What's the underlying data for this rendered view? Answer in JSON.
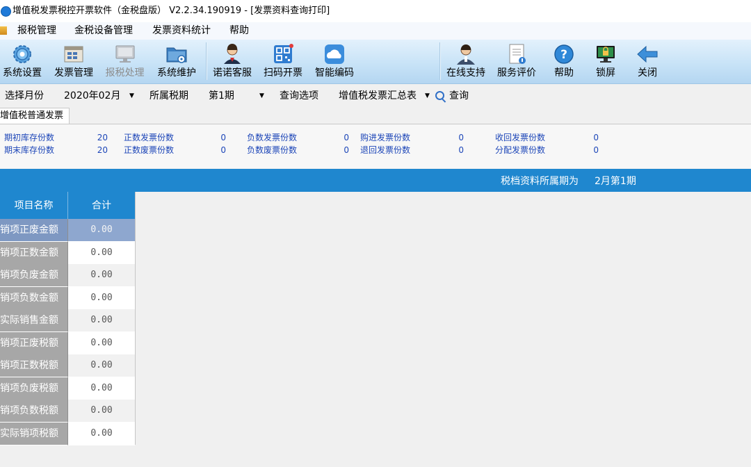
{
  "window": {
    "title": "增值税发票税控开票软件（金税盘版） V2.2.34.190919 - [发票资料查询打印]"
  },
  "menu": {
    "items": [
      "报税管理",
      "金税设备管理",
      "发票资料统计",
      "帮助"
    ]
  },
  "toolbar": {
    "buttons": [
      {
        "label": "系统设置",
        "icon": "gear-icon",
        "enabled": true
      },
      {
        "label": "发票管理",
        "icon": "invoice-manage-icon",
        "enabled": true
      },
      {
        "label": "报税处理",
        "icon": "monitor-icon",
        "enabled": false
      },
      {
        "label": "系统维护",
        "icon": "folder-gear-icon",
        "enabled": true
      },
      {
        "label": "诺诺客服",
        "icon": "customer-service-icon",
        "enabled": true
      },
      {
        "label": "扫码开票",
        "icon": "qr-code-icon",
        "enabled": true
      },
      {
        "label": "智能编码",
        "icon": "cloud-icon",
        "enabled": true
      },
      {
        "label": "在线支持",
        "icon": "support-person-icon",
        "enabled": true
      },
      {
        "label": "服务评价",
        "icon": "notebook-icon",
        "enabled": true
      },
      {
        "label": "帮助",
        "icon": "question-icon",
        "enabled": true
      },
      {
        "label": "锁屏",
        "icon": "lock-screen-icon",
        "enabled": true
      },
      {
        "label": "关闭",
        "icon": "arrow-left-icon",
        "enabled": true
      }
    ]
  },
  "filters": {
    "month_label": "选择月份",
    "month_value": "2020年02月",
    "period_label": "所属税期",
    "period_value": "第1期",
    "query_option_label": "查询选项",
    "query_option_value": "增值税发票汇总表",
    "query_button": "查询"
  },
  "tabs": [
    {
      "label": "增值税普通发票",
      "active": true
    }
  ],
  "stats": {
    "opening_stock": {
      "label": "期初库存份数",
      "value": "20"
    },
    "closing_stock": {
      "label": "期末库存份数",
      "value": "20"
    },
    "normal_issued": {
      "label": "正数发票份数",
      "value": "0"
    },
    "normal_void": {
      "label": "正数废票份数",
      "value": "0"
    },
    "negative_issued": {
      "label": "负数发票份数",
      "value": "0"
    },
    "negative_void": {
      "label": "负数废票份数",
      "value": "0"
    },
    "purchased": {
      "label": "购进发票份数",
      "value": "0"
    },
    "returned": {
      "label": "退回发票份数",
      "value": "0"
    },
    "recovered": {
      "label": "收回发票份数",
      "value": "0"
    },
    "distributed": {
      "label": "分配发票份数",
      "value": "0"
    }
  },
  "period_info": {
    "label": "税档资料所属期为",
    "value": "2月第1期"
  },
  "grid": {
    "columns": [
      "项目名称",
      "合计"
    ],
    "rows": [
      {
        "name": "销项正废金额",
        "total": "0.00"
      },
      {
        "name": "销项正数金额",
        "total": "0.00"
      },
      {
        "name": "销项负废金额",
        "total": "0.00"
      },
      {
        "name": "销项负数金额",
        "total": "0.00"
      },
      {
        "name": "实际销售金额",
        "total": "0.00"
      },
      {
        "name": "销项正废税额",
        "total": "0.00"
      },
      {
        "name": "销项正数税额",
        "total": "0.00"
      },
      {
        "name": "销项负废税额",
        "total": "0.00"
      },
      {
        "name": "销项负数税额",
        "total": "0.00"
      },
      {
        "name": "实际销项税额",
        "total": "0.00"
      }
    ]
  }
}
